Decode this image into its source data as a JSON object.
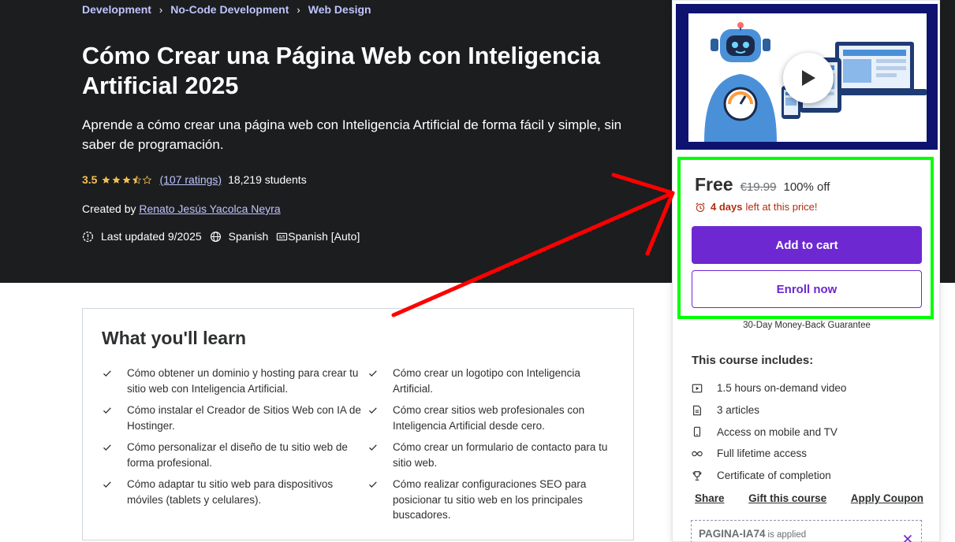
{
  "breadcrumb": [
    "Development",
    "No-Code Development",
    "Web Design"
  ],
  "course": {
    "title": "Cómo Crear una Página Web con Inteligencia Artificial 2025",
    "subtitle": "Aprende a cómo crear una página web con Inteligencia Artificial de forma fácil y simple, sin saber de programación.",
    "rating": "3.5",
    "rating_stars": 3.5,
    "ratings_count": "(107 ratings)",
    "students": "18,219 students",
    "created_by_label": "Created by",
    "instructor": "Renato Jesús Yacolca Neyra",
    "last_updated": "Last updated 9/2025",
    "language": "Spanish",
    "captions": "Spanish [Auto]"
  },
  "learn": {
    "title": "What you'll learn",
    "items": [
      "Cómo obtener un dominio y hosting para crear tu sitio web con Inteligencia Artificial.",
      "Cómo crear un logotipo con Inteligencia Artificial.",
      "Cómo instalar el Creador de Sitios Web con IA de Hostinger.",
      "Cómo crear sitios web profesionales con Inteligencia Artificial desde cero.",
      "Cómo personalizar el diseño de tu sitio web de forma profesional.",
      "Cómo crear un formulario de contacto para tu sitio web.",
      "Cómo adaptar tu sitio web para dispositivos móviles (tablets y celulares).",
      "Cómo realizar configuraciones SEO para posicionar tu sitio web en los principales buscadores."
    ]
  },
  "sidebar": {
    "price": "Free",
    "old_price": "€19.99",
    "discount": "100% off",
    "timer_bold": "4 days",
    "timer_rest": "left at this price!",
    "add_to_cart": "Add to cart",
    "enroll_now": "Enroll now",
    "guarantee": "30-Day Money-Back Guarantee",
    "includes_title": "This course includes:",
    "includes": [
      {
        "icon": "video-icon",
        "label": "1.5 hours on-demand video"
      },
      {
        "icon": "article-icon",
        "label": "3 articles"
      },
      {
        "icon": "mobile-icon",
        "label": "Access on mobile and TV"
      },
      {
        "icon": "infinity-icon",
        "label": "Full lifetime access"
      },
      {
        "icon": "trophy-icon",
        "label": "Certificate of completion"
      }
    ],
    "share": "Share",
    "gift": "Gift this course",
    "apply_coupon": "Apply Coupon",
    "coupon_code": "PAGINA-IA74",
    "coupon_applied": "is applied"
  },
  "colors": {
    "hero_bg": "#1c1d1f",
    "accent_purple": "#6d28d2",
    "link_lavender": "#c0c4fc",
    "star_gold": "#f4c150",
    "timer_red": "#b32d0f",
    "highlight_green": "#00ff00",
    "annotation_red": "#ff0000"
  }
}
